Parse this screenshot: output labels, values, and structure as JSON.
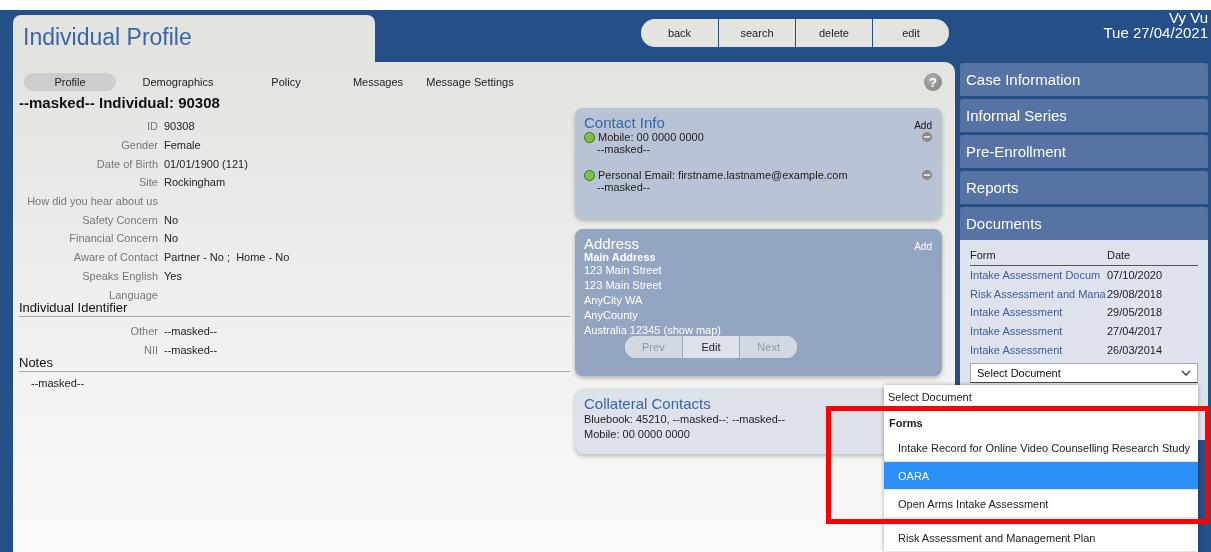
{
  "page_title": "Individual Profile",
  "toolbar": [
    "back",
    "search",
    "delete",
    "edit"
  ],
  "user": {
    "name": "Vy Vu",
    "date": "Tue 27/04/2021"
  },
  "tabs": [
    {
      "label": "Profile",
      "selected": true
    },
    {
      "label": "Demographics",
      "selected": false
    },
    {
      "label": "Policy",
      "selected": false
    },
    {
      "label": "Messages",
      "selected": false
    },
    {
      "label": "Message Settings",
      "selected": false
    }
  ],
  "help": "?",
  "heading": "--masked-- Individual: 90308",
  "fields": [
    {
      "label": "ID",
      "value": "90308"
    },
    {
      "label": "Gender",
      "value": "Female"
    },
    {
      "label": "Date of Birth",
      "value": "01/01/1900 (121)"
    },
    {
      "label": "Site",
      "value": "Rockingham"
    },
    {
      "label": "How did you hear about us"
    },
    {
      "label": "Safety Concern",
      "value": "No"
    },
    {
      "label": "Financial Concern",
      "value": "No"
    },
    {
      "label": "Aware of Contact",
      "value": "Partner - No ;  Home - No"
    },
    {
      "label": "Speaks English",
      "value": "Yes"
    },
    {
      "label": "Language"
    }
  ],
  "identifier": {
    "title": "Individual Identifier",
    "fields": [
      {
        "label": "Other",
        "value": "--masked--"
      },
      {
        "label": "NII",
        "value": "--masked--"
      }
    ]
  },
  "notes": {
    "title": "Notes",
    "text": "--masked--"
  },
  "contact_info": {
    "title": "Contact Info",
    "add": "Add",
    "items": [
      {
        "text": "Mobile: 00 0000 0000",
        "note": "--masked--",
        "color": "#7cc242"
      },
      {
        "text": "Personal Email: firstname.lastname@example.com",
        "note": "--masked--",
        "color": "#7cc242"
      }
    ]
  },
  "address": {
    "title": "Address",
    "add": "Add",
    "name": "Main Address",
    "lines": [
      "123 Main Street",
      "123 Main Street",
      "AnyCity WA",
      "AnyCounty",
      "Australia 12345 (show map)"
    ],
    "pager": [
      {
        "label": "Prev",
        "disabled": true
      },
      {
        "label": "Edit",
        "disabled": false
      },
      {
        "label": "Next",
        "disabled": true
      }
    ]
  },
  "collateral": {
    "title": "Collateral Contacts",
    "lines": [
      "Bluebook: 45210, --masked--: --masked--",
      "Mobile: 00 0000 0000"
    ]
  },
  "sidebar": {
    "items": [
      "Case Information",
      "Informal Series",
      "Pre-Enrollment",
      "Reports",
      "Documents"
    ],
    "documents": {
      "columns": [
        "Form",
        "Date"
      ],
      "rows": [
        [
          "Intake Assessment Docum",
          "07/10/2020"
        ],
        [
          "Risk Assessment and Mana",
          "29/08/2018"
        ],
        [
          "Intake Assessment",
          "29/05/2018"
        ],
        [
          "Intake Assessment",
          "27/04/2017"
        ],
        [
          "Intake Assessment",
          "26/03/2014"
        ]
      ],
      "select": "Select Document"
    }
  },
  "dropdown": [
    {
      "kind": "placeholder",
      "label": "Select Document",
      "selected": false
    },
    {
      "kind": "group",
      "label": "Forms"
    },
    {
      "kind": "option",
      "label": "Intake Record for Online Video Counselling Research Study",
      "selected": false
    },
    {
      "kind": "option",
      "label": "OARA",
      "selected": true
    },
    {
      "kind": "option",
      "label": "Open Arms Intake Assessment",
      "selected": false
    },
    {
      "kind": "option",
      "label": "Risk Assessment and Management Plan",
      "selected": false
    }
  ]
}
